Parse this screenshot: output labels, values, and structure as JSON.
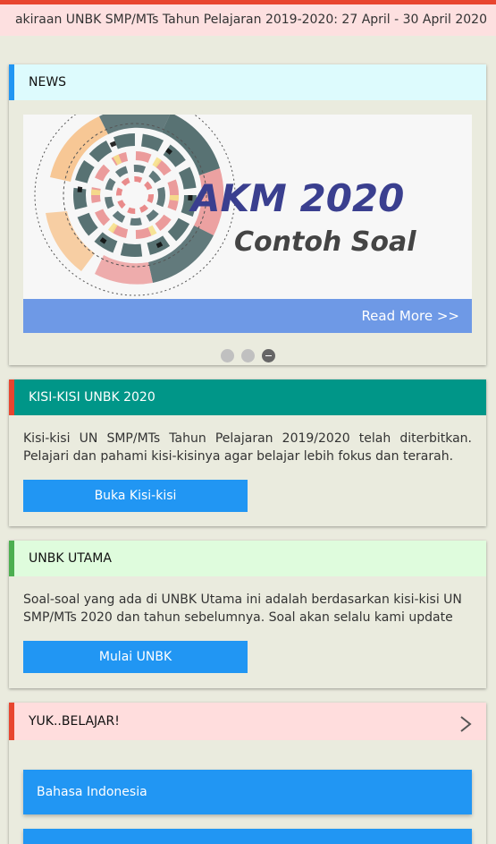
{
  "marquee": {
    "text": "akiraan UNBK SMP/MTs Tahun Pelajaran 2019-2020: 27 April - 30 April 2020"
  },
  "news": {
    "title": "NEWS",
    "banner": {
      "headline": "AKM 2020",
      "subheadline": "Contoh Soal",
      "read_more": "Read More >>"
    },
    "slides": 3,
    "active_slide": 3
  },
  "kisi": {
    "title": "KISI-KISI UNBK 2020",
    "text": "Kisi-kisi UN SMP/MTs Tahun Pelajaran 2019/2020 telah diterbitkan. Pelajari dan pahami kisi-kisinya agar belajar lebih fokus dan terarah.",
    "button": "Buka Kisi-kisi"
  },
  "utama": {
    "title": "UNBK UTAMA",
    "text": "Soal-soal yang ada di UNBK Utama ini adalah berdasarkan kisi-kisi UN SMP/MTs 2020 dan tahun sebelumnya. Soal akan selalu kami update",
    "button": "Mulai UNBK"
  },
  "belajar": {
    "title": "YUK..BELAJAR!",
    "subjects": [
      "Bahasa Indonesia",
      ""
    ]
  },
  "colors": {
    "accent_red": "#e8452f",
    "accent_blue": "#2196f3",
    "teal": "#009688",
    "green": "#4caf50",
    "background": "#eaebde"
  }
}
